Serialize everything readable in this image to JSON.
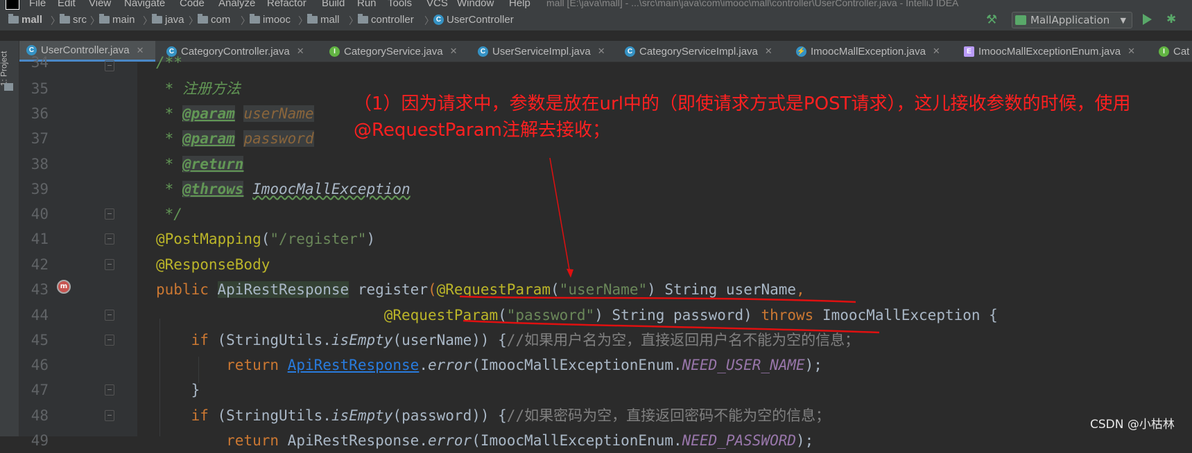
{
  "menubar": {
    "items": [
      "File",
      "Edit",
      "View",
      "Navigate",
      "Code",
      "Analyze",
      "Refactor",
      "Build",
      "Run",
      "Tools",
      "VCS",
      "Window",
      "Help"
    ],
    "window_title": "mall [E:\\java\\mall] - ...\\src\\main\\java\\com\\imooc\\mall\\controller\\UserController.java - IntelliJ IDEA"
  },
  "breadcrumb": {
    "items": [
      "mall",
      "src",
      "main",
      "java",
      "com",
      "imooc",
      "mall",
      "controller",
      "UserController"
    ]
  },
  "toolbar": {
    "run_config": "MallApplication"
  },
  "tabs": [
    {
      "label": "UserController.java",
      "icon": "class-icon"
    },
    {
      "label": "CategoryController.java",
      "icon": "class-icon"
    },
    {
      "label": "CategoryService.java",
      "icon": "interface-icon"
    },
    {
      "label": "UserServiceImpl.java",
      "icon": "class-icon"
    },
    {
      "label": "CategoryServiceImpl.java",
      "icon": "class-icon"
    },
    {
      "label": "ImoocMallException.java",
      "icon": "exception-icon"
    },
    {
      "label": "ImoocMallExceptionEnum.java",
      "icon": "enum-icon"
    },
    {
      "label": "Cat",
      "icon": "interface-icon"
    }
  ],
  "side_panel": {
    "project_tab": "1: Project"
  },
  "editor": {
    "line_numbers": [
      "34",
      "35",
      "36",
      "37",
      "38",
      "39",
      "40",
      "41",
      "42",
      "43",
      "44",
      "45",
      "46",
      "47",
      "48",
      "49"
    ],
    "code": {
      "l35": "注册方法",
      "l36_tag": "@param",
      "l36_name": "userName",
      "l37_tag": "@param",
      "l37_name": "password",
      "l38_tag": "@return",
      "l39_tag": "@throws",
      "l39_exc": "ImoocMallException",
      "l41_ann": "@PostMapping",
      "l41_str": "\"/register\"",
      "l42_ann": "@ResponseBody",
      "l43_kw": "public",
      "l43_type": "ApiRestResponse",
      "l43_fn": "register",
      "l43_ann": "@RequestParam",
      "l43_str": "\"userName\"",
      "l43_rest": "String userName",
      "l44_ann": "@RequestParam",
      "l44_str": "\"password\"",
      "l44_rest": "String password)",
      "l44_throws": "throws",
      "l44_exc": "ImoocMallException {",
      "l45_kw": "if",
      "l45_a": "(StringUtils.",
      "l45_fn": "isEmpty",
      "l45_b": "(userName)) {",
      "l45_cm": "//如果用户名为空，直接返回用户名不能为空的信息；",
      "l46_kw": "return",
      "l46_cls": "ApiRestResponse",
      "l46_fn": "error",
      "l46_a": "(ImoocMallExceptionEnum.",
      "l46_cst": "NEED_USER_NAME",
      "l46_b": ");",
      "l47": "}",
      "l48_kw": "if",
      "l48_a": "(StringUtils.",
      "l48_fn": "isEmpty",
      "l48_b": "(password)) {",
      "l48_cm": "//如果密码为空，直接返回密码不能为空的信息；",
      "l49_kw": "return",
      "l49_cls": "ApiRestResponse",
      "l49_fn": "error",
      "l49_a": "(ImoocMallExceptionEnum.",
      "l49_cst": "NEED_PASSWORD",
      "l49_b": ");"
    }
  },
  "annotation": {
    "text": "（1）因为请求中，参数是放在url中的（即使请求方式是POST请求），这儿接收参数的时候，使用@RequestParam注解去接收；",
    "color": "#ff2020"
  },
  "watermark": "CSDN @小枯林"
}
